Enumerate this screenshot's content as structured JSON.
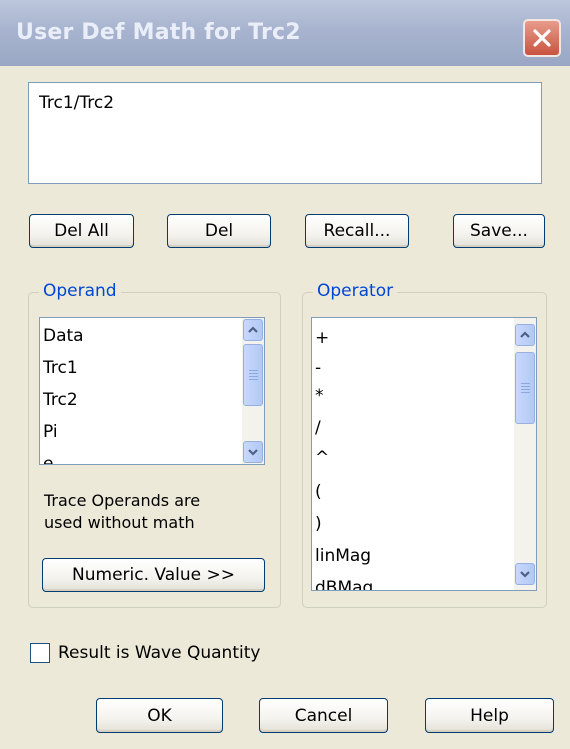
{
  "dialog": {
    "title": "User Def Math for Trc2",
    "expression": "Trc1/Trc2"
  },
  "buttons": {
    "del_all": "Del All",
    "del": "Del",
    "recall": "Recall...",
    "save": "Save...",
    "numeric_value": "Numeric. Value >>",
    "ok": "OK",
    "cancel": "Cancel",
    "help": "Help"
  },
  "operand": {
    "legend": "Operand",
    "items": [
      "Data",
      "Trc1",
      "Trc2",
      "Pi",
      "e"
    ],
    "note_line1": "Trace Operands are",
    "note_line2": "used without math"
  },
  "operator": {
    "legend": "Operator",
    "items": [
      "+",
      "-",
      "*",
      "/",
      "^",
      "(",
      ")",
      "linMag",
      "dBMag"
    ]
  },
  "wave_quantity": {
    "label": "Result is Wave Quantity",
    "checked": false
  },
  "icons": {
    "close": "close-icon",
    "scroll_up": "chevron-up-icon",
    "scroll_down": "chevron-down-icon"
  },
  "colors": {
    "title_bar": "#a8b4cf",
    "group_legend": "#0046d5",
    "close_button": "#c9533f",
    "dialog_background": "#ece9d8"
  }
}
